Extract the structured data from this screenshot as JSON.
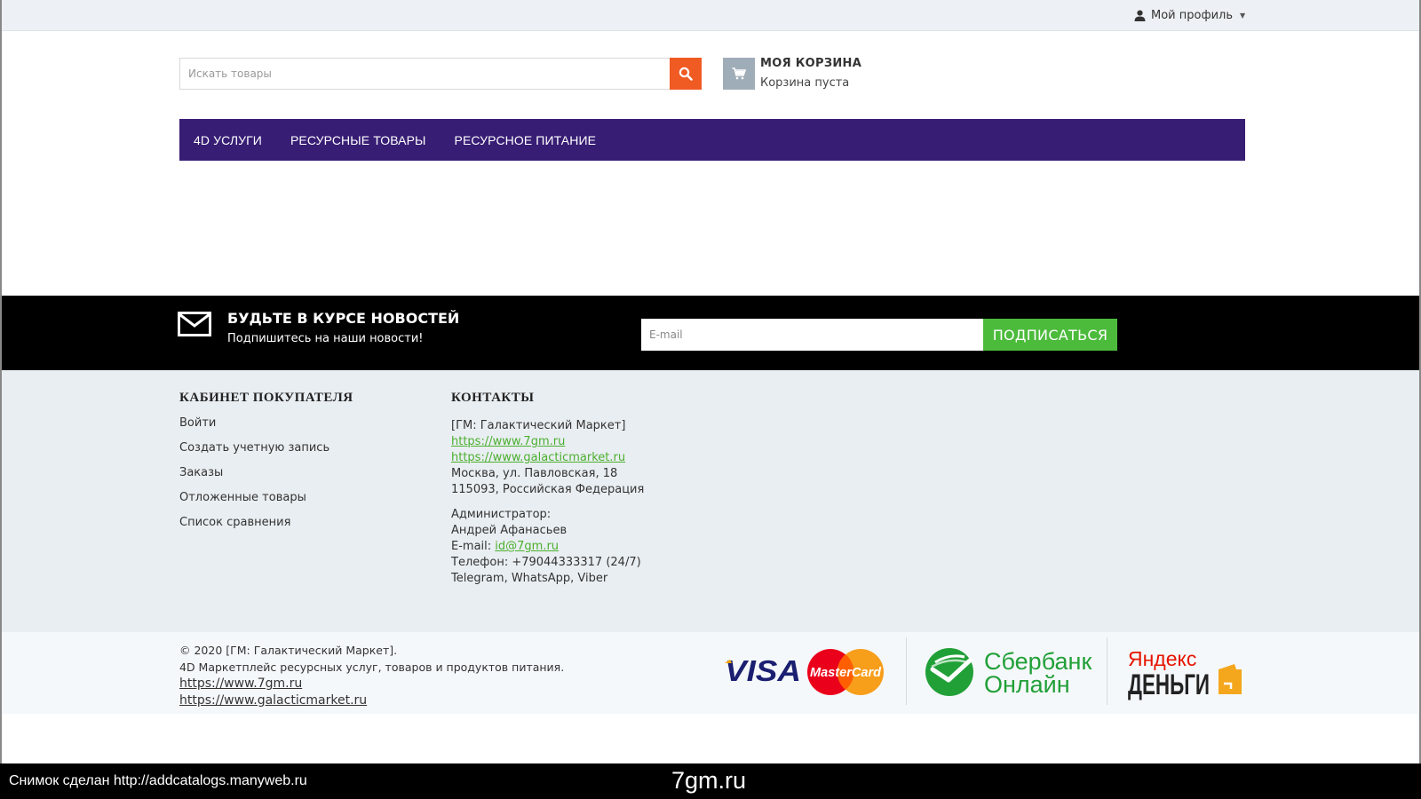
{
  "topbar": {
    "profile_label": "Мой профиль",
    "profile_icon": "user-icon"
  },
  "header": {
    "search_placeholder": "Искать товары",
    "cart_title": "МОЯ КОРЗИНА",
    "cart_status": "Корзина пуста"
  },
  "nav": {
    "items": [
      {
        "label": "4D УСЛУГИ"
      },
      {
        "label": "РЕСУРСНЫЕ ТОВАРЫ"
      },
      {
        "label": "РЕСУРСНОЕ ПИТАНИЕ"
      }
    ]
  },
  "newsletter": {
    "title": "БУДЬТЕ В КУРСЕ НОВОСТЕЙ",
    "subtitle": "Подпишитесь на наши новости!",
    "email_placeholder": "E-mail",
    "subscribe_label": "ПОДПИСАТЬСЯ"
  },
  "footer": {
    "account": {
      "title": "КАБИНЕТ ПОКУПАТЕЛЯ",
      "links": [
        "Войти",
        "Создать учетную запись",
        "Заказы",
        "Отложенные товары",
        "Список сравнения"
      ]
    },
    "contacts": {
      "title": "КОНТАКТЫ",
      "company": "[ГМ: Галактический Маркет]",
      "url1": "https://www.7gm.ru",
      "url2": "https://www.galacticmarket.ru",
      "address1": "Москва, ул. Павловская, 18",
      "address2": "115093, Российская Федерация",
      "admin_label": "Администратор:",
      "admin_name": "Андрей Афанасьев",
      "email_label": "E-mail:",
      "email": "id@7gm.ru",
      "phone": "Телефон: +79044333317 (24/7)",
      "messengers": "Telegram, WhatsApp, Viber"
    }
  },
  "bottom": {
    "copyright": "© 2020 [ГМ: Галактический Маркет].",
    "description": "4D Маркетплейс ресурсных услуг, товаров и продуктов питания.",
    "url1": "https://www.7gm.ru",
    "url2": "https://www.galacticmarket.ru",
    "payments": {
      "visa": "VISA",
      "mastercard": "MasterCard",
      "sber_line1": "Сбербанк",
      "sber_line2": "Онлайн",
      "yandex_line1": "Яндекс",
      "yandex_line2": "ДЕНЬГИ"
    }
  },
  "caption": {
    "left": "Снимок сделан http://addcatalogs.manyweb.ru",
    "center": "7gm.ru"
  },
  "colors": {
    "nav_bg": "#371d74",
    "search_button": "#f05a23",
    "subscribe_button": "#4cbb3c",
    "link_green": "#4caf2f",
    "footer_bg": "#e9eef2"
  }
}
